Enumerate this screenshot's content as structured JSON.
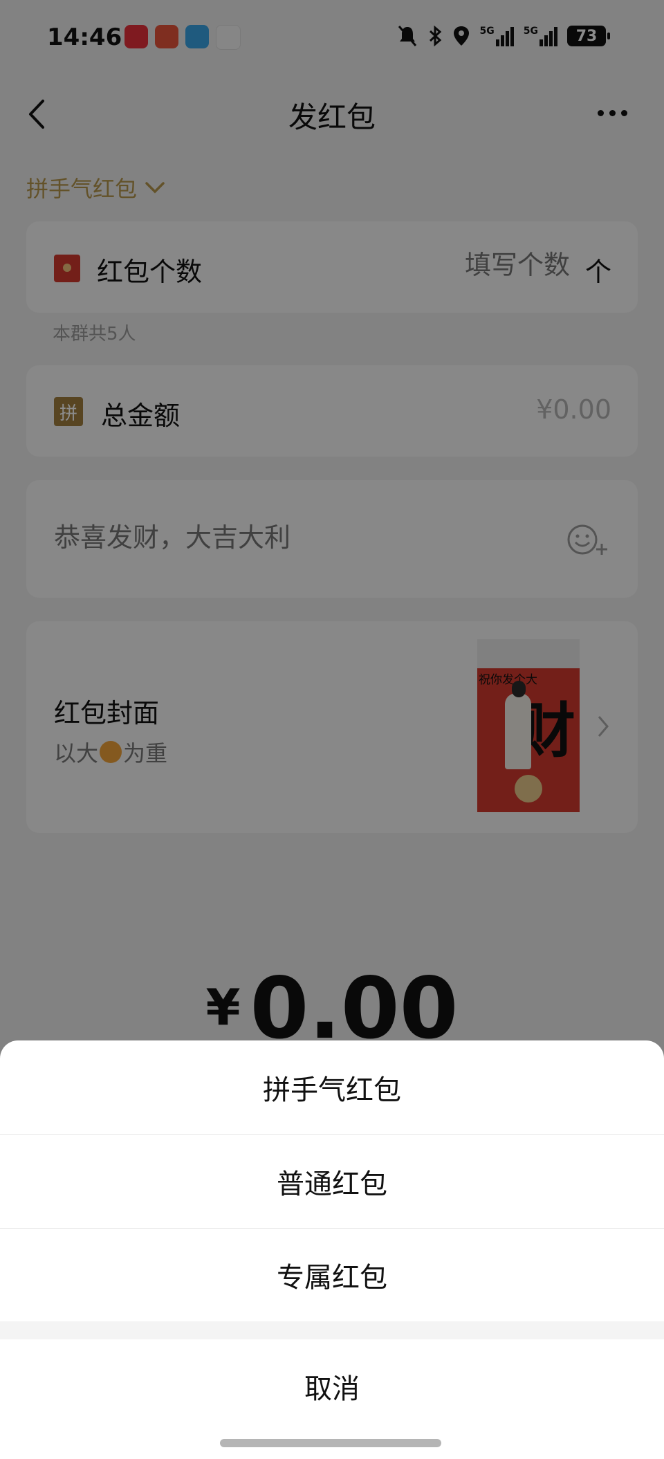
{
  "status_bar": {
    "time": "14:46",
    "battery": "73",
    "network1": "5G",
    "network2": "5G",
    "app_icons": [
      "xiaohongshu-icon",
      "tomato-icon",
      "telegram-icon",
      "peoples-daily-icon"
    ]
  },
  "nav": {
    "title": "发红包"
  },
  "type_selector": {
    "label": "拼手气红包"
  },
  "count_row": {
    "label": "红包个数",
    "placeholder": "填写个数",
    "unit": "个"
  },
  "group_note": "本群共5人",
  "amount_row": {
    "badge": "拼",
    "label": "总金额",
    "value": "¥0.00"
  },
  "greeting": {
    "placeholder": "恭喜发财，大吉大利"
  },
  "cover": {
    "title": "红包封面",
    "subtitle_prefix": "以大",
    "subtitle_suffix": "为重",
    "image_text": "祝你发个大",
    "image_big_char": "财"
  },
  "total": {
    "currency": "¥",
    "amount": "0.00"
  },
  "sheet": {
    "options": [
      "拼手气红包",
      "普通红包",
      "专属红包"
    ],
    "cancel": "取消"
  },
  "colors": {
    "accent_gold": "#b5954c",
    "red": "#d23a2e",
    "overlay": "rgba(0,0,0,0.45)"
  }
}
